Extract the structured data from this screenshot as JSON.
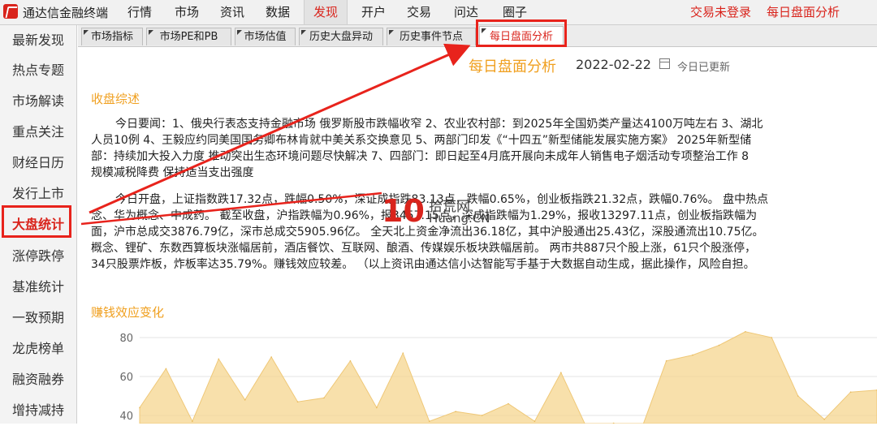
{
  "app": {
    "title": "通达信金融终端"
  },
  "menu": [
    "行情",
    "市场",
    "资讯",
    "数据",
    "发现",
    "开户",
    "交易",
    "问达",
    "圈子"
  ],
  "menu_active_index": 4,
  "top_right": {
    "login_status": "交易未登录",
    "feature": "每日盘面分析"
  },
  "sidebar": {
    "items": [
      "最新发现",
      "热点专题",
      "市场解读",
      "重点关注",
      "财经日历",
      "发行上市",
      "大盘统计",
      "涨停跌停",
      "基准统计",
      "一致预期",
      "龙虎榜单",
      "融资融券",
      "增持减持"
    ],
    "active_index": 6
  },
  "tabs": {
    "items": [
      "市场指标",
      "市场PE和PB",
      "市场估值",
      "历史大盘异动",
      "历史事件节点",
      "每日盘面分析"
    ],
    "active_index": 5
  },
  "page": {
    "title": "每日盘面分析",
    "date": "2022-02-22",
    "update_note": "今日已更新"
  },
  "summary": {
    "title": "收盘综述",
    "p1": [
      "今日要闻：1、俄央行表态支持金融市场 俄罗斯股市跌幅收窄 2、农业农村部：到2025年全国奶类产量达4100万吨左右 3、湖北",
      "人员10例 4、王毅应约同美国国务卿布林肯就中美关系交换意见 5、两部门印发《“十四五”新型储能发展实施方案》 2025年新型储",
      "部：持续加大投入力度 推动突出生态环境问题尽快解决 7、四部门：即日起至4月底开展向未成年人销售电子烟活动专项整治工作 8",
      "规模减税降费 保持适当支出强度"
    ],
    "p2": [
      "今日开盘，上证指数跌17.32点，跌幅0.50%，深证成指跌83.13点，跌幅0.65%，创业板指跌21.32点，跌幅0.76%。 盘中热点",
      "念、华为概念、中成药。 截至收盘，沪指跌幅为0.96%，报3457.15点，深成指跌幅为1.29%，报收13297.11点，创业板指跌幅为",
      "面，沪市总成交3876.79亿，深市总成交5905.96亿。 全天北上资金净流出36.18亿，其中沪股通出25.43亿，深股通流出10.75亿。",
      "概念、锂矿、东数西算板块涨幅居前，酒店餐饮、互联网、酿酒、传媒娱乐板块跌幅居前。 两市共887只个股上涨，61只个股涨停，",
      "34只股票炸板，炸板率达35.79%。赚钱效应较差。 （以上资讯由通达信小达智能写手基于大数据自动生成，据此操作，风险自担。"
    ]
  },
  "watermark": {
    "num": "10",
    "cn": "拾荒网",
    "en": "Huang.CN"
  },
  "effect_chart_title": "赚钱效应变化",
  "chart_data": {
    "type": "area",
    "title": "赚钱效应变化",
    "xlabel": "",
    "ylabel": "",
    "y_ticks": [
      80,
      60,
      40
    ],
    "ylim": [
      30,
      80
    ],
    "x": [
      1,
      2,
      3,
      4,
      5,
      6,
      7,
      8,
      9,
      10,
      11,
      12,
      13,
      14,
      15,
      16,
      17,
      18,
      19,
      20,
      21,
      22,
      23,
      24,
      25,
      26,
      27,
      28,
      29
    ],
    "values": [
      44,
      64,
      37,
      69,
      48,
      70,
      47,
      49,
      68,
      44,
      72,
      37,
      42,
      40,
      46,
      37,
      62,
      33,
      36,
      31,
      68,
      71,
      76,
      83,
      80,
      50,
      38,
      52,
      53
    ],
    "grid": true,
    "color": "#f5d58f"
  },
  "colors": {
    "accent": "#d9241c",
    "title_orange": "#f0a020",
    "area_fill": "#f5d58f"
  }
}
